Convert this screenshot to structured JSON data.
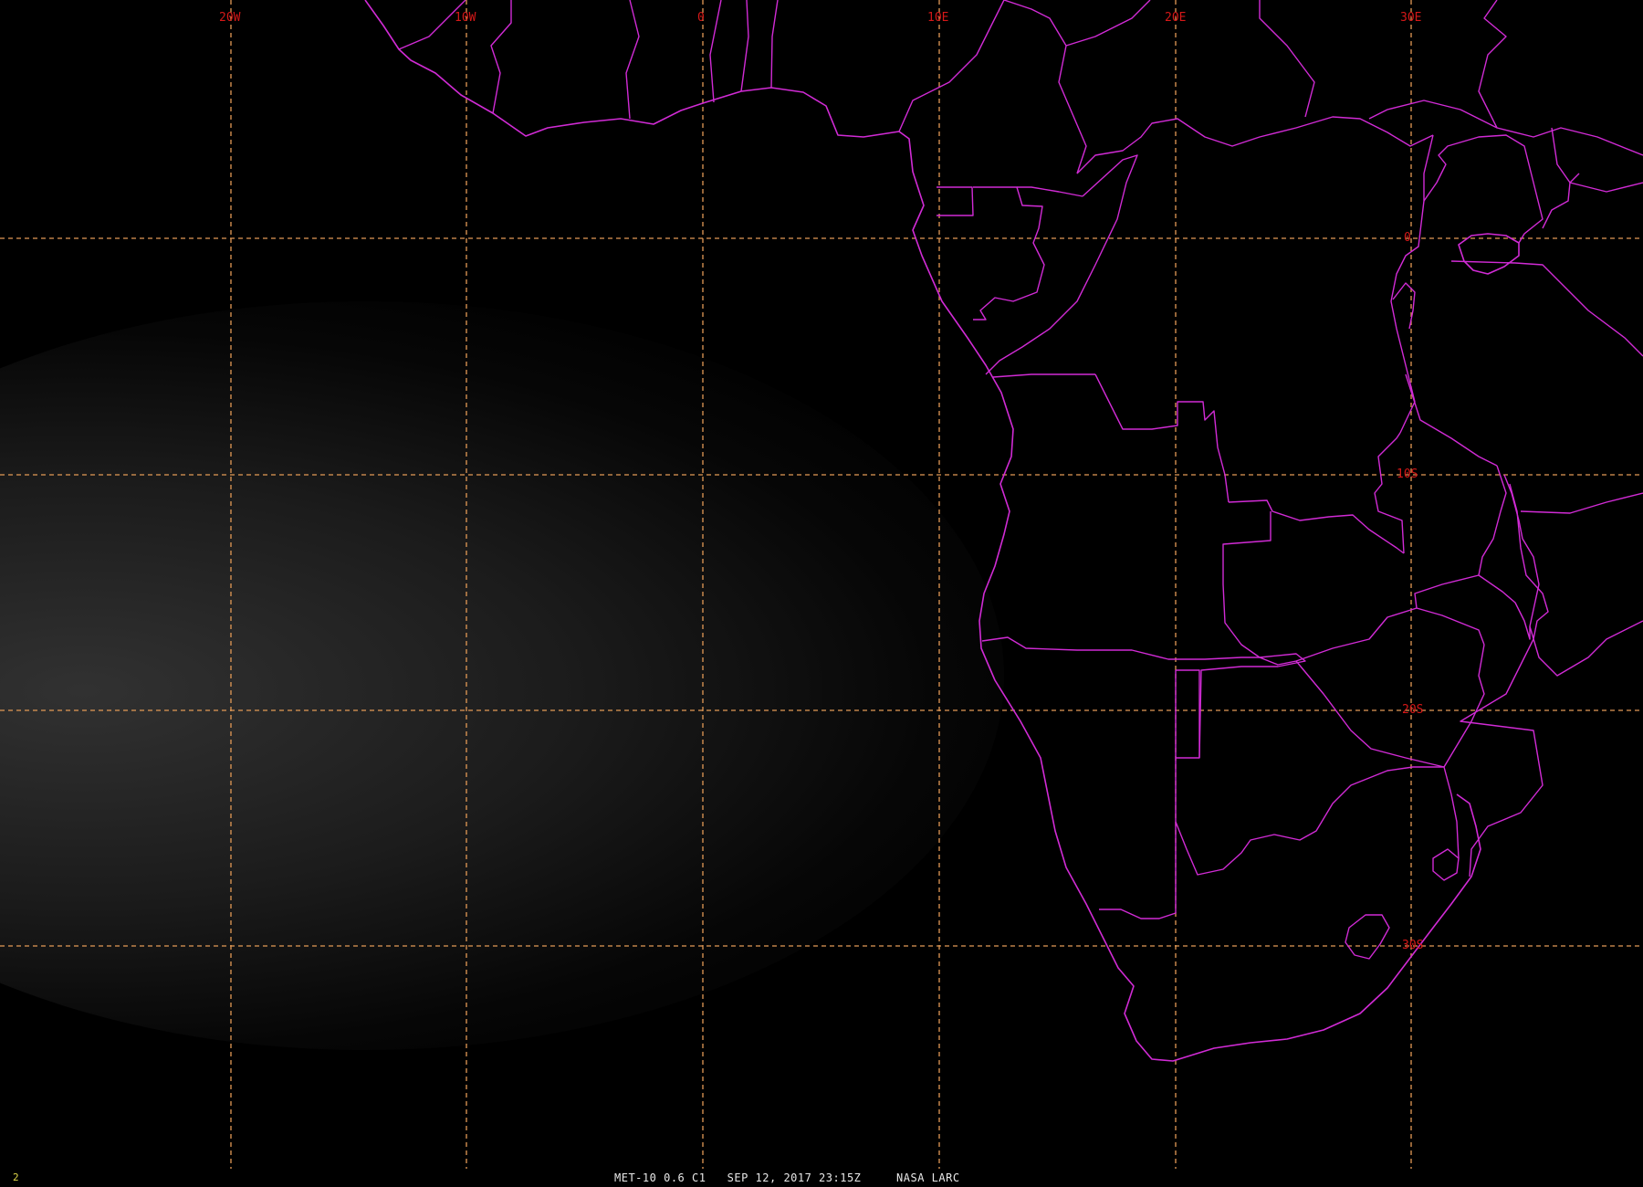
{
  "map": {
    "longitude_labels": [
      "20W",
      "10W",
      "0",
      "10E",
      "20E",
      "30E"
    ],
    "latitude_labels": [
      "0",
      "10S",
      "20S",
      "30S"
    ],
    "colors": {
      "background": "#000000",
      "grid": "#e39a56",
      "labels": "#d51818",
      "boundaries": "#d12bd5",
      "frame_number": "#e0d84a"
    },
    "icons": [
      "coastline-boundary",
      "lat-lon-grid"
    ]
  },
  "status": {
    "frame_number": "2",
    "satellite": "MET-10",
    "channel": "0.6 C1",
    "datetime": "SEP 12, 2017 23:15Z",
    "source": "NASA LARC"
  }
}
